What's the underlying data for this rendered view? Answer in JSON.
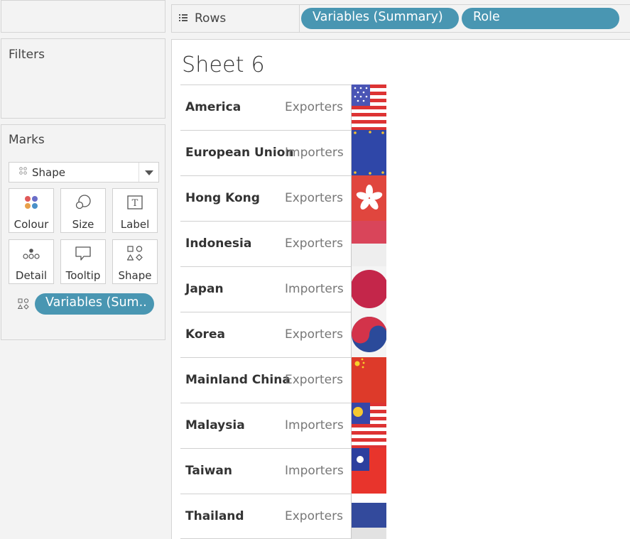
{
  "rows_shelf": {
    "label": "Rows",
    "pills": [
      "Variables (Summary)",
      "Role"
    ]
  },
  "filters": {
    "title": "Filters"
  },
  "marks": {
    "title": "Marks",
    "mark_type": "Shape",
    "buttons": {
      "colour": "Colour",
      "size": "Size",
      "label": "Label",
      "detail": "Detail",
      "tooltip": "Tooltip",
      "shape": "Shape"
    },
    "shape_pill": "Variables (Sum..",
    "accent_color": "#4996b2"
  },
  "sheet": {
    "title": "Sheet 6",
    "rows": [
      {
        "country": "America",
        "role": "Exporters",
        "flag": "usa-flag-icon"
      },
      {
        "country": "European Union",
        "role": "Importers",
        "flag": "eu-flag-icon"
      },
      {
        "country": "Hong Kong",
        "role": "Exporters",
        "flag": "hong-kong-flag-icon"
      },
      {
        "country": "Indonesia",
        "role": "Exporters",
        "flag": "indonesia-flag-icon"
      },
      {
        "country": "Japan",
        "role": "Importers",
        "flag": "japan-flag-icon"
      },
      {
        "country": "Korea",
        "role": "Exporters",
        "flag": "korea-flag-icon"
      },
      {
        "country": "Mainland China",
        "role": "Exporters",
        "flag": "china-flag-icon"
      },
      {
        "country": "Malaysia",
        "role": "Importers",
        "flag": "malaysia-flag-icon"
      },
      {
        "country": "Taiwan",
        "role": "Importers",
        "flag": "taiwan-flag-icon"
      },
      {
        "country": "Thailand",
        "role": "Exporters",
        "flag": "thailand-flag-icon"
      }
    ]
  }
}
